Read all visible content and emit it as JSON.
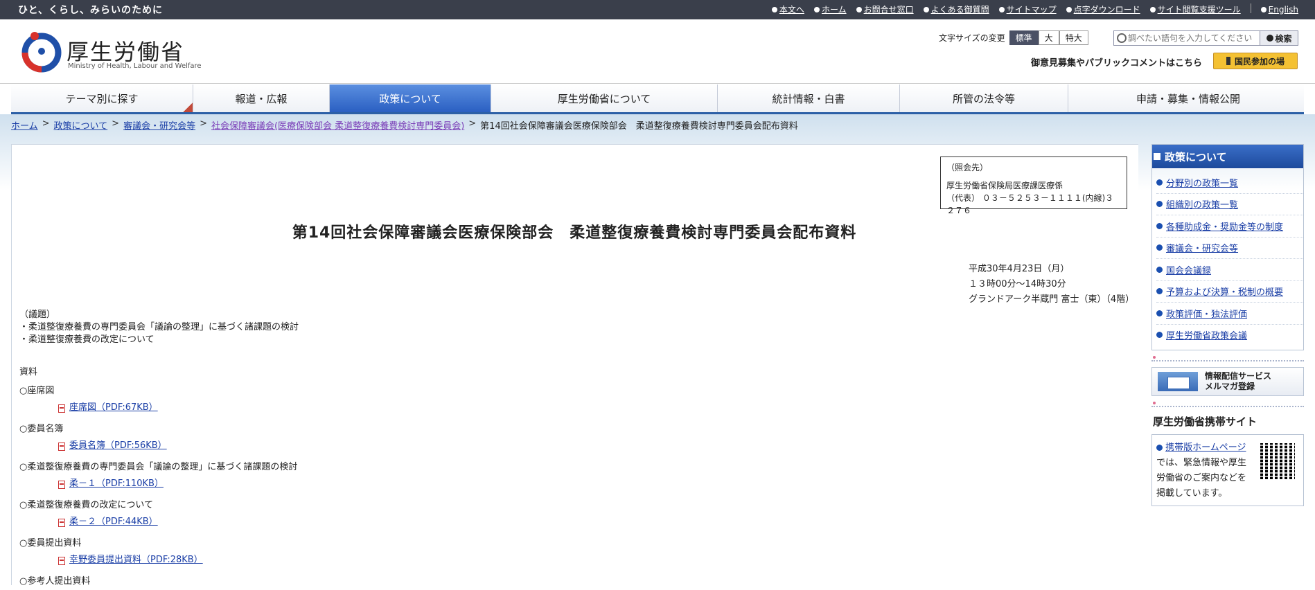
{
  "topbar": {
    "tagline": "ひと、くらし、みらいのために",
    "links": [
      "本文へ",
      "ホーム",
      "お問合せ窓口",
      "よくある御質問",
      "サイトマップ",
      "点字ダウンロード",
      "サイト閲覧支援ツール",
      "English"
    ]
  },
  "header": {
    "logo_title": "厚生労働省",
    "logo_subtitle": "Ministry of Health, Labour and Welfare",
    "fontsize_label": "文字サイズの変更",
    "fontsize_options": [
      "標準",
      "大",
      "特大"
    ],
    "search_placeholder": "調べたい語句を入力してください",
    "search_button": "検索",
    "opinion_text": "御意見募集やパブリックコメントはこちら",
    "participate_button": "国民参加の場"
  },
  "gnav": [
    "テーマ別に探す",
    "報道・広報",
    "政策について",
    "厚生労働省について",
    "統計情報・白書",
    "所管の法令等",
    "申請・募集・情報公開"
  ],
  "breadcrumb": {
    "items": [
      "ホーム",
      "政策について",
      "審議会・研究会等",
      "社会保障審議会(医療保険部会 柔道整復療養費検討専門委員会)"
    ],
    "current": "第14回社会保障審議会医療保険部会　柔道整復療養費検討専門委員会配布資料"
  },
  "contact": {
    "heading": "（照会先）",
    "dept": "厚生労働省保険局医療課医療係",
    "phone": "（代表） ０３－５２５３－１１１１(内線)３２７６"
  },
  "title": "第14回社会保障審議会医療保険部会　柔道整復療養費検討専門委員会配布資料",
  "date": {
    "date": "平成30年4月23日（月）",
    "time": "１３時00分～14時30分",
    "place": "グランドアーク半蔵門 富士（東）（4階）"
  },
  "agenda": {
    "heading": "（議題）",
    "items": [
      "・柔道整復療養費の専門委員会「議論の整理」に基づく諸課題の検討",
      "・柔道整復療養費の改定について"
    ]
  },
  "materials": {
    "heading": "資料",
    "sections": [
      {
        "title": "○座席図",
        "file": "座席図（PDF:67KB）"
      },
      {
        "title": "○委員名簿",
        "file": "委員名簿（PDF:56KB）"
      },
      {
        "title": "○柔道整復療養費の専門委員会「議論の整理」に基づく諸課題の検討",
        "file": "柔－１（PDF:110KB）"
      },
      {
        "title": "○柔道整復療養費の改定について",
        "file": "柔－２（PDF:44KB）"
      },
      {
        "title": "○委員提出資料",
        "file": "幸野委員提出資料（PDF:28KB）"
      }
    ],
    "last_section": "○参考人提出資料"
  },
  "sidebar": {
    "heading": "政策について",
    "items": [
      "分野別の政策一覧",
      "組織別の政策一覧",
      "各種助成金・奨励金等の制度",
      "審議会・研究会等",
      "国会会議録",
      "予算および決算・税制の概要",
      "政策評価・独法評価",
      "厚生労働省政策会議"
    ],
    "mail_line1": "情報配信サービス",
    "mail_line2": "メルマガ登録",
    "mobile_title": "厚生労働省携帯サイト",
    "mobile_link": "携帯版ホームページ",
    "mobile_text": "では、緊急情報や厚生労働省のご案内などを掲載しています。"
  }
}
